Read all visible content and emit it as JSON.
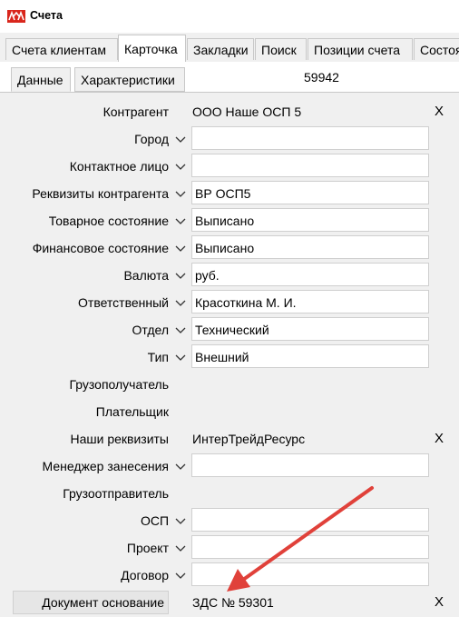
{
  "window": {
    "title": "Счета"
  },
  "tabs": [
    "Счета клиентам",
    "Карточка",
    "Закладки",
    "Поиск",
    "Позиции счета",
    "Состоя"
  ],
  "subtabs": [
    "Данные",
    "Характеристики"
  ],
  "doc_number": "59942",
  "rows": [
    {
      "label": "Контрагент",
      "type": "text",
      "value": "ООО Наше ОСП 5",
      "clear": "X"
    },
    {
      "label": "Город",
      "type": "field",
      "value": ""
    },
    {
      "label": "Контактное лицо",
      "type": "field",
      "value": ""
    },
    {
      "label": "Реквизиты контрагента",
      "type": "field",
      "value": "ВР ОСП5"
    },
    {
      "label": "Товарное состояние",
      "type": "field",
      "value": "Выписано"
    },
    {
      "label": "Финансовое состояние",
      "type": "field",
      "value": "Выписано"
    },
    {
      "label": "Валюта",
      "type": "field",
      "value": "руб."
    },
    {
      "label": "Ответственный",
      "type": "field",
      "value": "Красоткина М. И."
    },
    {
      "label": "Отдел",
      "type": "field",
      "value": "Технический"
    },
    {
      "label": "Тип",
      "type": "field",
      "value": "Внешний"
    },
    {
      "label": "Грузополучатель",
      "type": "none"
    },
    {
      "label": "Плательщик",
      "type": "none"
    },
    {
      "label": "Наши реквизиты",
      "type": "text",
      "value": "ИнтерТрейдРесурс",
      "clear": "X"
    },
    {
      "label": "Менеджер занесения",
      "type": "field",
      "value": ""
    },
    {
      "label": "Грузоотправитель",
      "type": "none"
    },
    {
      "label": "ОСП",
      "type": "field",
      "value": ""
    },
    {
      "label": "Проект",
      "type": "field",
      "value": ""
    },
    {
      "label": "Договор",
      "type": "field",
      "value": ""
    },
    {
      "label": "Документ основание",
      "type": "text",
      "value": "ЗДС № 59301",
      "clear": "X",
      "boxed": true
    }
  ],
  "colors": {
    "arrow": "#e0413a",
    "logo": "#d9261c"
  }
}
